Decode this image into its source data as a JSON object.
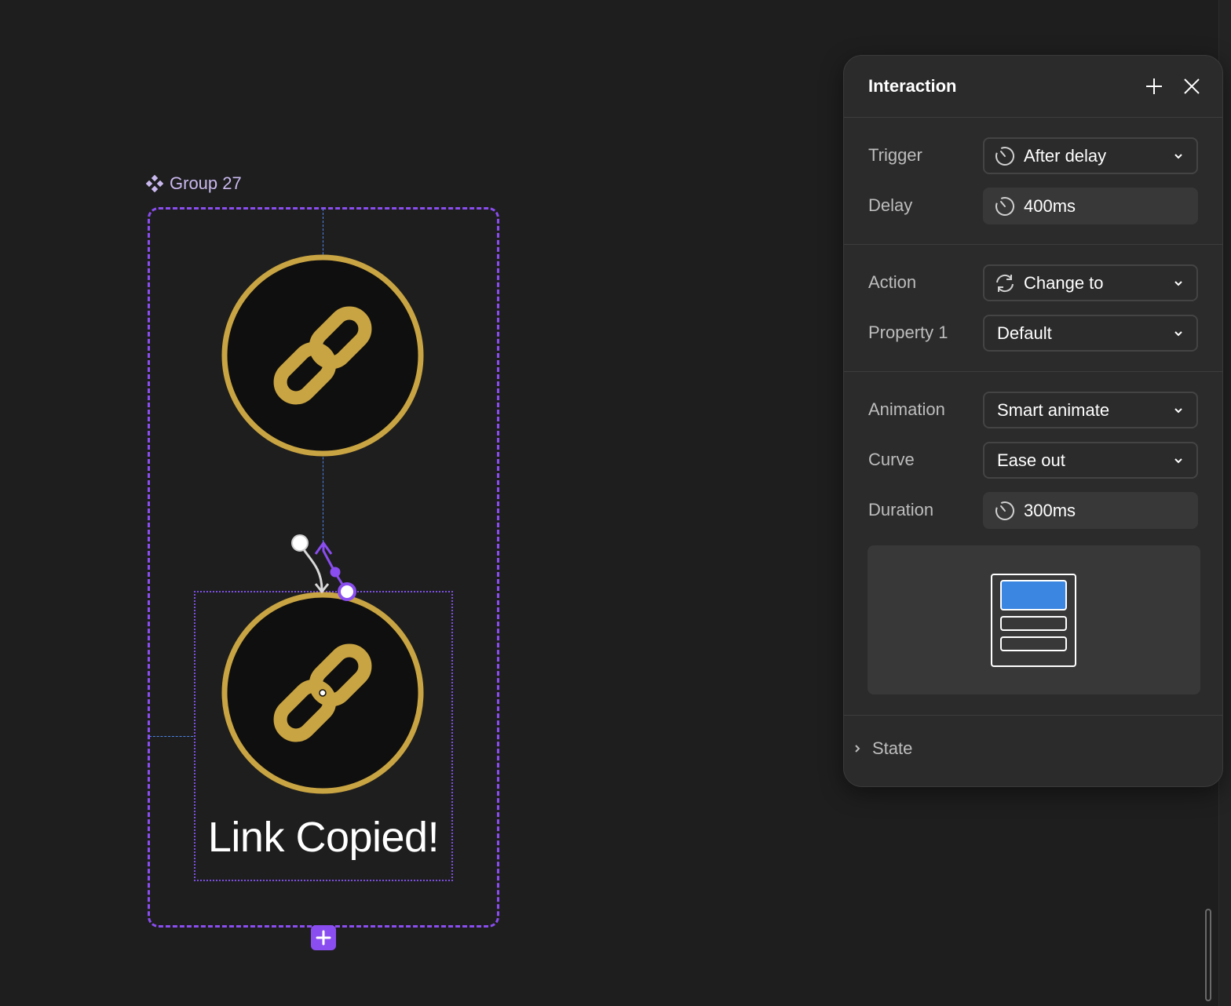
{
  "canvas": {
    "group_label": "Group 27",
    "caption": "Link Copied!",
    "icons": {
      "group": "component-icon",
      "link_top": "link-chain-icon",
      "link_bottom": "link-chain-icon",
      "add": "plus-icon"
    },
    "colors": {
      "selection": "#8a4df0",
      "guide": "#4d84e3",
      "gold": "#c9a442",
      "badge_bg": "#0f0f0f"
    }
  },
  "panel": {
    "title": "Interaction",
    "add_icon": "plus-icon",
    "close_icon": "close-icon",
    "trigger": {
      "label": "Trigger",
      "value": "After delay",
      "icon": "timer-icon"
    },
    "delay": {
      "label": "Delay",
      "value": "400ms",
      "icon": "timer-icon"
    },
    "action": {
      "label": "Action",
      "value": "Change to",
      "icon": "refresh-icon"
    },
    "property": {
      "label": "Property 1",
      "value": "Default"
    },
    "animation": {
      "label": "Animation",
      "value": "Smart animate"
    },
    "curve": {
      "label": "Curve",
      "value": "Ease out"
    },
    "duration": {
      "label": "Duration",
      "value": "300ms",
      "icon": "timer-icon"
    },
    "preview_icon": "smart-animate-preview-icon",
    "state": {
      "label": "State",
      "icon": "chevron-right-icon"
    },
    "accent": "#3b86e0"
  }
}
